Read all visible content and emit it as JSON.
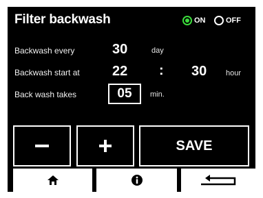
{
  "header": {
    "title": "Filter backwash",
    "toggle": {
      "on_label": "ON",
      "off_label": "OFF",
      "selected": "ON",
      "accent": "#3cdc3c"
    }
  },
  "settings": {
    "every": {
      "label": "Backwash every",
      "value": "30",
      "unit": "day"
    },
    "start": {
      "label": "Backwash start at",
      "hour": "22",
      "separator": ":",
      "minute": "30",
      "unit": "hour"
    },
    "duration": {
      "label": "Back wash takes",
      "value": "05",
      "unit": "min."
    }
  },
  "controls": {
    "minus_icon": "minus-icon",
    "plus_icon": "plus-icon",
    "save_label": "SAVE"
  },
  "nav": {
    "home_icon": "home-icon",
    "info_icon": "info-icon",
    "back_icon": "back-arrow-icon"
  }
}
